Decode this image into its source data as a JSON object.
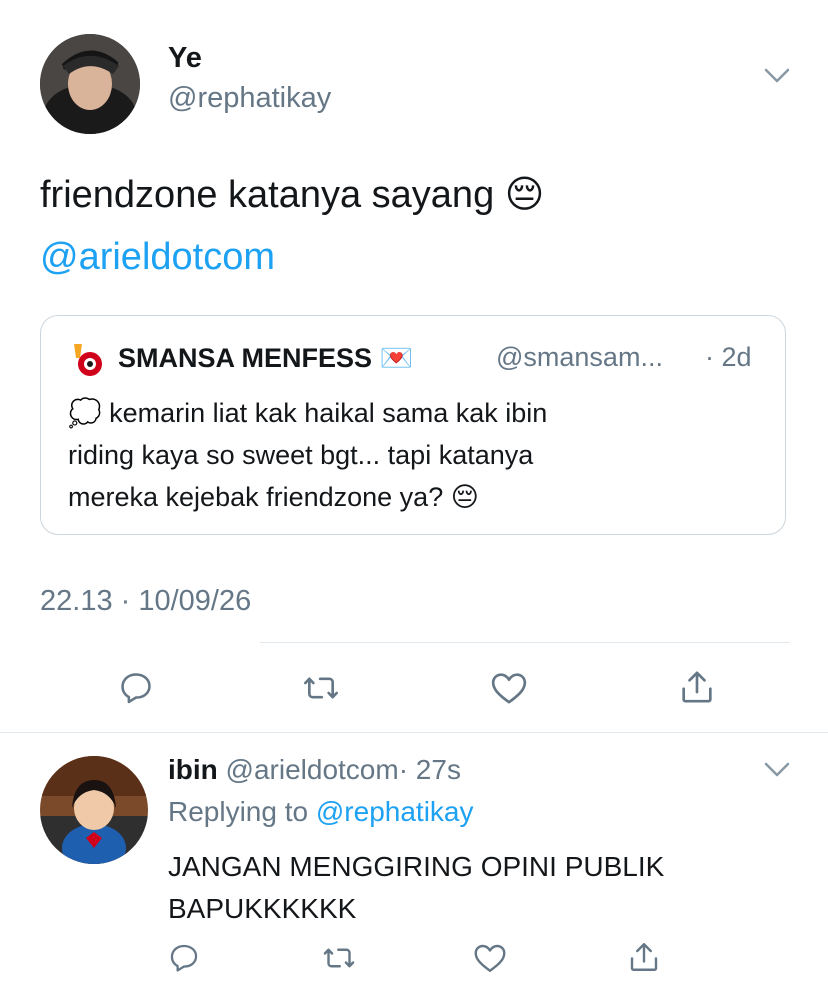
{
  "main_tweet": {
    "author_name": "Ye",
    "author_handle": "@rephatikay",
    "text": "friendzone katanya sayang",
    "text_emoji": "😔",
    "mention": "@arieldotcom",
    "timestamp": "22.13 · 10/09/26"
  },
  "quoted_tweet": {
    "name": "SMANSA MENFESS",
    "name_emoji": "💌",
    "handle": "@smansam...",
    "age": "· 2d",
    "badge_emoji": "❗",
    "lead_emoji": "💭",
    "text_line1": "kemarin liat kak haikal sama kak ibin",
    "text_line2": "riding kaya so sweet bgt... tapi katanya",
    "text_line3": "mereka kejebak friendzone ya?",
    "text_emoji": "😔"
  },
  "reply": {
    "author_name": "ibin",
    "author_handle": "@arieldotcom",
    "age": "· 27s",
    "replying_prefix": "Replying to",
    "replying_handle": "@rephatikay",
    "text_line1": "JANGAN MENGGIRING OPINI PUBLIK",
    "text_line2": "BAPUKKKKKK"
  },
  "icons": {
    "reply": "comment-icon",
    "retweet": "retweet-icon",
    "like": "heart-icon",
    "share": "share-icon",
    "more": "chevron-down-icon"
  },
  "colors": {
    "text": "#14171a",
    "muted": "#657786",
    "link": "#1da1f2",
    "border": "#e1e8ed",
    "background": "#ffffff"
  }
}
